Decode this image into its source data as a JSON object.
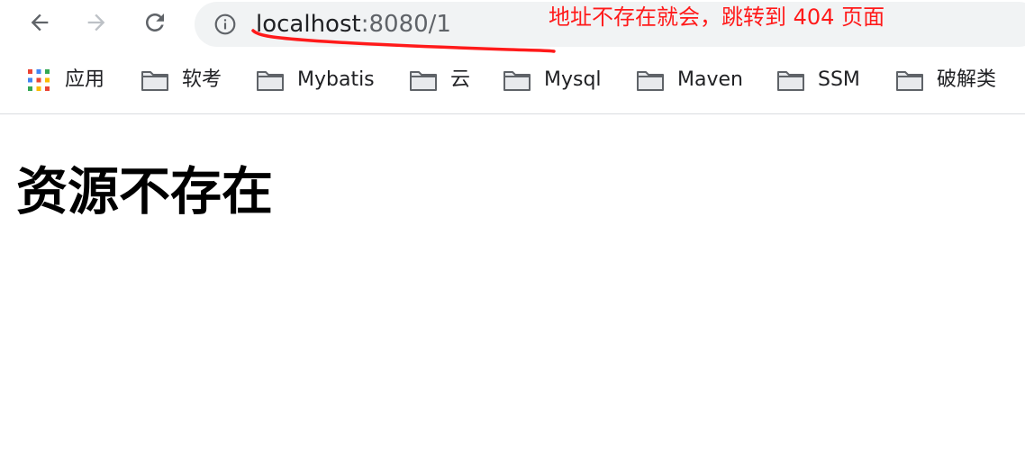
{
  "browser": {
    "nav": {
      "back_icon": "arrow-left-icon",
      "forward_icon": "arrow-right-icon",
      "reload_icon": "reload-icon"
    },
    "address_bar": {
      "info_icon": "info-icon",
      "host": "localhost",
      "path": ":8080/1"
    },
    "bookmarks": [
      {
        "label": "应用",
        "icon": "apps-grid-icon"
      },
      {
        "label": "软考",
        "icon": "folder-icon"
      },
      {
        "label": "Mybatis",
        "icon": "folder-icon"
      },
      {
        "label": "云",
        "icon": "folder-icon"
      },
      {
        "label": "Mysql",
        "icon": "folder-icon"
      },
      {
        "label": "Maven",
        "icon": "folder-icon"
      },
      {
        "label": "SSM",
        "icon": "folder-icon"
      },
      {
        "label": "破解类",
        "icon": "folder-icon"
      }
    ]
  },
  "annotation": {
    "text": "地址不存在就会，跳转到 404 页面",
    "color": "#ff1a1a"
  },
  "page": {
    "heading": "资源不存在"
  }
}
